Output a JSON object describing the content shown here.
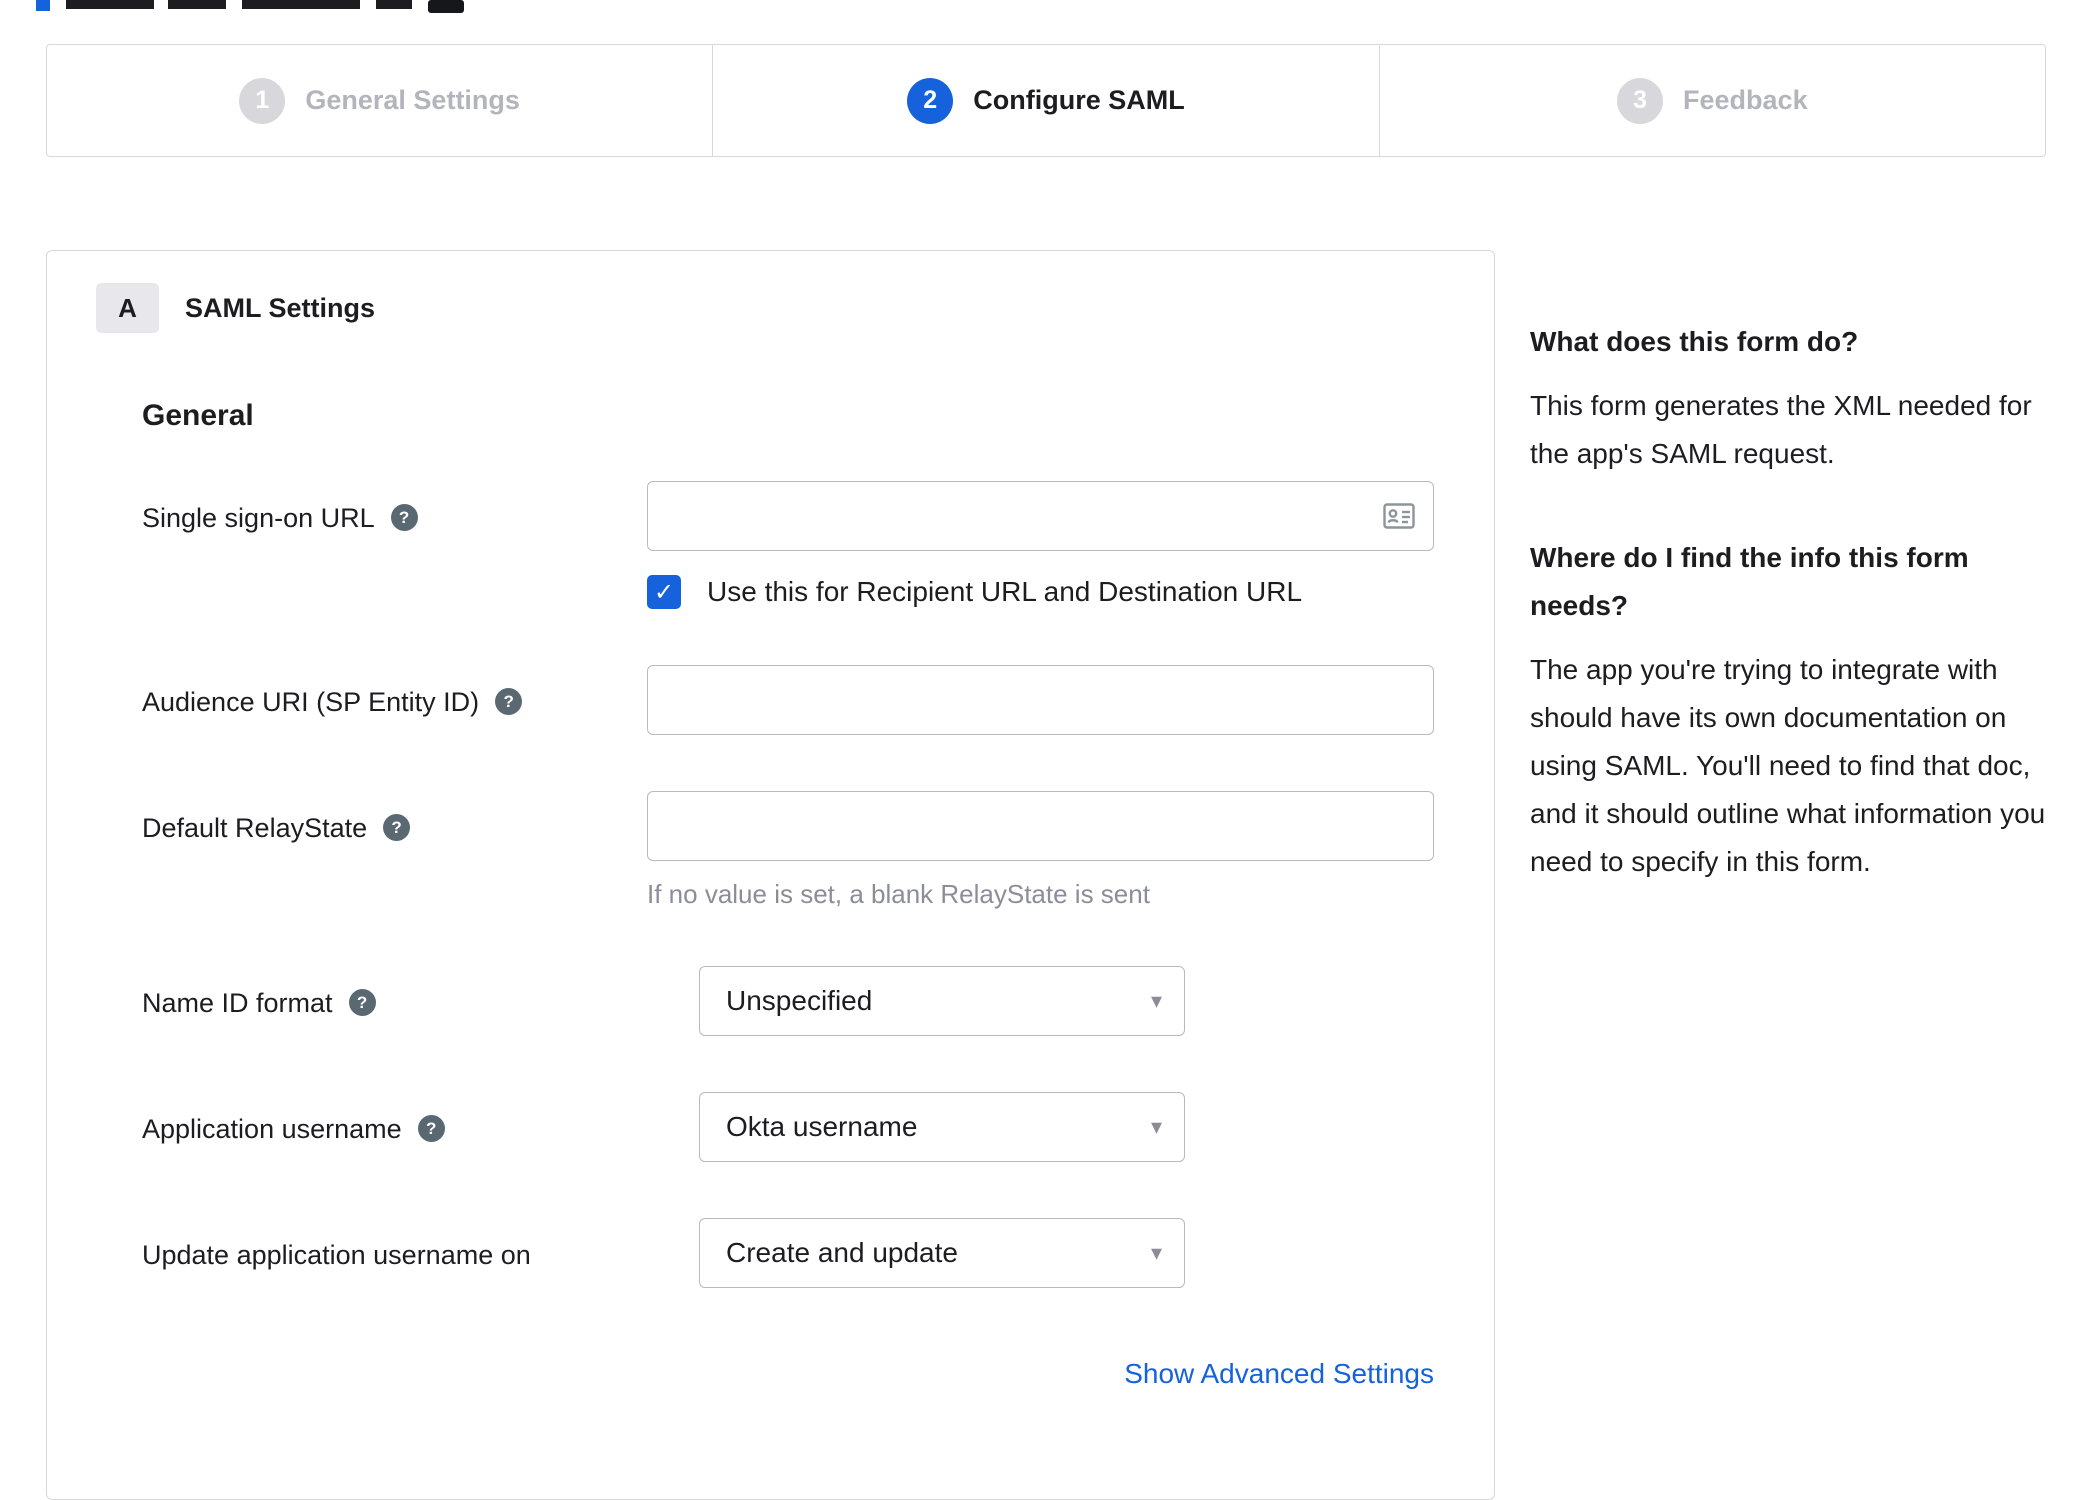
{
  "stepper": {
    "steps": [
      {
        "number": "1",
        "label": "General Settings",
        "state": "inactive"
      },
      {
        "number": "2",
        "label": "Configure SAML",
        "state": "active"
      },
      {
        "number": "3",
        "label": "Feedback",
        "state": "inactive"
      }
    ]
  },
  "form": {
    "section_badge": "A",
    "section_title": "SAML Settings",
    "group_title": "General",
    "fields": {
      "sso_url": {
        "label": "Single sign-on URL",
        "value": "",
        "checkbox_label": "Use this for Recipient URL and Destination URL",
        "checkbox_checked": true
      },
      "audience_uri": {
        "label": "Audience URI (SP Entity ID)",
        "value": ""
      },
      "relay_state": {
        "label": "Default RelayState",
        "value": "",
        "hint": "If no value is set, a blank RelayState is sent"
      },
      "name_id_format": {
        "label": "Name ID format",
        "value": "Unspecified"
      },
      "app_username": {
        "label": "Application username",
        "value": "Okta username"
      },
      "update_app_username": {
        "label": "Update application username on",
        "value": "Create and update"
      }
    },
    "advanced_link": "Show Advanced Settings"
  },
  "sidebar": {
    "sections": [
      {
        "title": "What does this form do?",
        "body": "This form generates the XML needed for the app's SAML request."
      },
      {
        "title": "Where do I find the info this form needs?",
        "body": "The app you're trying to integrate with should have its own documentation on using SAML. You'll need to find that doc, and it should outline what information you need to specify in this form."
      }
    ]
  },
  "icons": {
    "help": "question-icon",
    "checkbox": "check-icon",
    "input_addon": "contact-card-icon",
    "caret": "chevron-down-icon"
  },
  "colors": {
    "accent": "#1662dd",
    "link": "#1662dd",
    "inactive_step": "#d7d7dc",
    "inactive_text": "#b4b4bc",
    "border": "#d8d8dc",
    "input_border": "#b9b9c0",
    "hint_text": "#8d8d99",
    "text": "#1d1d21"
  }
}
